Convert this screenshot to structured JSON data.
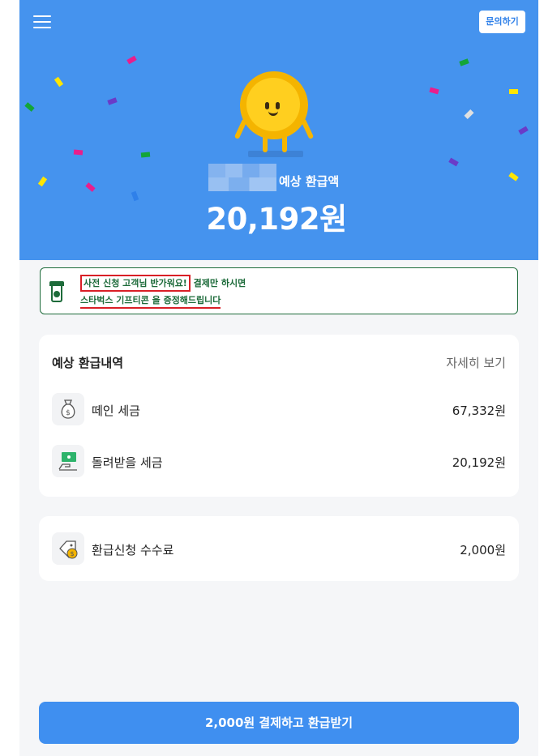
{
  "header": {
    "menu_icon": "hamburger-menu-icon",
    "inquiry_label": "문의하기",
    "refund_label": "예상 환급액",
    "refund_amount": "20,192원",
    "background_color": "#4593ee"
  },
  "banner": {
    "highlight_text": "사전 신청 고객님 반가워요!",
    "line1_rest": " 결제만 하시면",
    "line2": "스타벅스 기프티콘 을 증정해드립니다",
    "icon": "starbucks-cup-icon",
    "accent_color": "#1d6b3a"
  },
  "refund_details": {
    "title": "예상 환급내역",
    "detail_link": "자세히 보기",
    "items": [
      {
        "label": "떼인 세금",
        "value": "67,332원",
        "icon": "money-bag-icon"
      },
      {
        "label": "돌려받을 세금",
        "value": "20,192원",
        "icon": "cash-hand-icon"
      }
    ]
  },
  "fee": {
    "label": "환급신청 수수료",
    "value": "2,000원",
    "icon": "price-tag-coin-icon"
  },
  "pay_button": {
    "label": "2,000원 결제하고 환급받기",
    "color": "#3f8ff0"
  }
}
